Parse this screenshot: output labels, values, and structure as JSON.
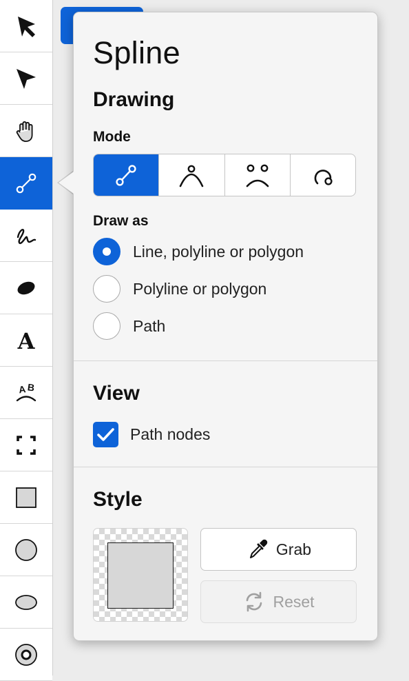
{
  "toolbar": {
    "tools": [
      {
        "name": "selector-tool",
        "icon": "arrow-select-icon"
      },
      {
        "name": "node-tool",
        "icon": "node-arrow-icon"
      },
      {
        "name": "pan-tool",
        "icon": "hand-icon"
      },
      {
        "name": "spline-tool",
        "icon": "spline-icon",
        "active": true
      },
      {
        "name": "freehand-tool",
        "icon": "freehand-icon"
      },
      {
        "name": "brush-tool",
        "icon": "brush-blob-icon"
      },
      {
        "name": "text-tool",
        "icon": "text-icon"
      },
      {
        "name": "text-on-path-tool",
        "icon": "text-path-icon"
      },
      {
        "name": "crop-tool",
        "icon": "crop-frame-icon"
      },
      {
        "name": "rectangle-tool",
        "icon": "rectangle-icon"
      },
      {
        "name": "circle-tool",
        "icon": "circle-icon"
      },
      {
        "name": "ellipse-tool",
        "icon": "ellipse-icon"
      },
      {
        "name": "ring-tool",
        "icon": "ring-icon"
      }
    ]
  },
  "panel": {
    "title": "Spline",
    "drawing_heading": "Drawing",
    "mode_label": "Mode",
    "modes": [
      {
        "icon": "spline-mode-icon",
        "active": true
      },
      {
        "icon": "arc-mode-icon"
      },
      {
        "icon": "curve-mode-icon"
      },
      {
        "icon": "loop-mode-icon"
      }
    ],
    "draw_as_label": "Draw as",
    "draw_as_options": [
      {
        "label": "Line, polyline or polygon",
        "selected": true
      },
      {
        "label": "Polyline or polygon",
        "selected": false
      },
      {
        "label": "Path",
        "selected": false
      }
    ],
    "view_heading": "View",
    "path_nodes_label": "Path nodes",
    "path_nodes_checked": true,
    "style_heading": "Style",
    "grab_label": "Grab",
    "reset_label": "Reset"
  },
  "colors": {
    "accent": "#0e63d8",
    "swatch_fill": "#d7d7d7"
  }
}
